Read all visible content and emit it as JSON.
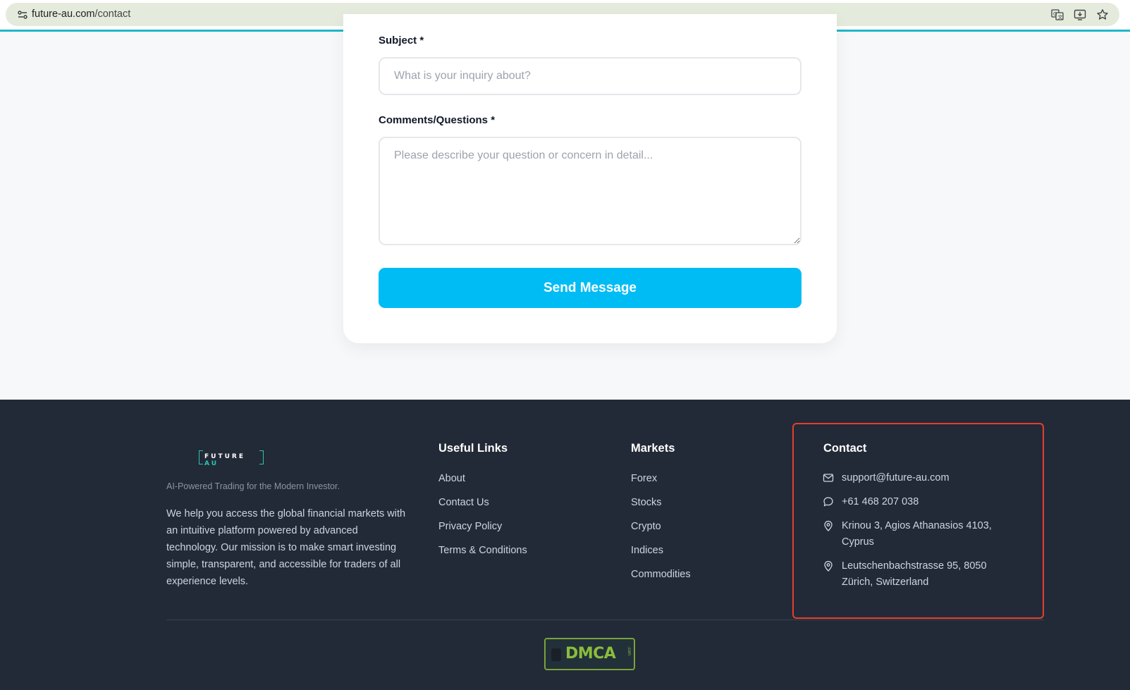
{
  "browser": {
    "url_host": "future-au.com",
    "url_path": "/contact",
    "icons": [
      "site-info-icon",
      "translate-icon",
      "install-app-icon",
      "bookmark-star-icon"
    ]
  },
  "form": {
    "subject_label": "Subject",
    "subject_placeholder": "What is your inquiry about?",
    "comments_label": "Comments/Questions",
    "comments_placeholder": "Please describe your question or concern in detail...",
    "required_mark": "*",
    "send_button": "Send Message"
  },
  "footer": {
    "logo": {
      "text": "FUTURE",
      "accent_text": "AU"
    },
    "tagline": "AI-Powered Trading for the Modern Investor.",
    "about": "We help you access the global financial markets with an intuitive platform powered by advanced technology. Our mission is to make smart investing simple, transparent, and accessible for traders of all experience levels.",
    "useful_links": {
      "title": "Useful Links",
      "items": [
        "About",
        "Contact Us",
        "Privacy Policy",
        "Terms & Conditions"
      ]
    },
    "markets": {
      "title": "Markets",
      "items": [
        "Forex",
        "Stocks",
        "Crypto",
        "Indices",
        "Commodities"
      ]
    },
    "contact": {
      "title": "Contact",
      "email": "support@future-au.com",
      "phone": "+61 468 207 038",
      "address1_line1": "Krinou 3, Agios Athanasios 4103,",
      "address1_line2": "Cyprus",
      "address2_line1": "Leutschenbachstrasse 95, 8050",
      "address2_line2": "Zürich, Switzerland",
      "icons": [
        "mail-icon",
        "chat-bubble-icon",
        "map-pin-icon",
        "map-pin-icon"
      ]
    },
    "badge": {
      "text": "DMCA",
      "suffix": ".com"
    }
  },
  "colors": {
    "accent": "#00bcf5",
    "footer_bg": "#222a37",
    "highlight_border": "#e53e2f",
    "logo_accent": "#2cc4b0",
    "dmca_green": "#8bbd3a"
  }
}
